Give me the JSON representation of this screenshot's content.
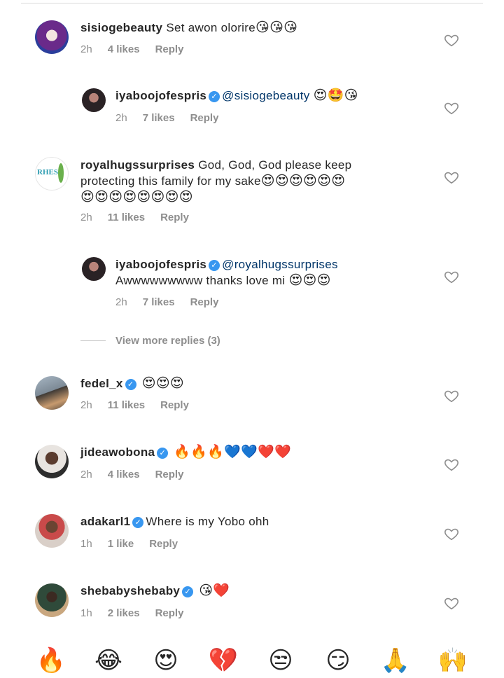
{
  "comments": [
    {
      "username": "sisiogebeauty",
      "verified": false,
      "text": "Set awon olorire",
      "emojis": "😘😘😘",
      "time": "2h",
      "likes": "4 likes",
      "reply": "Reply"
    },
    {
      "username": "iyaboojofespris",
      "verified": true,
      "mention": "@sisiogebeauty",
      "emojis": "😍🤩😘",
      "time": "2h",
      "likes": "7 likes",
      "reply": "Reply"
    },
    {
      "username": "royalhugssurprises",
      "verified": false,
      "text_line1": "God, God, God please keep",
      "text_line2": "protecting this family  for my sake",
      "emojis_line2": "😍😍😍😍😍😍",
      "emojis_line3": "😍😍😍😍😍😍😍😍",
      "time": "2h",
      "likes": "11 likes",
      "reply": "Reply",
      "avatar_text": "RHES"
    },
    {
      "username": "iyaboojofespris",
      "verified": true,
      "mention": "@royalhugssurprises",
      "text": "Awwwwwwwww  thanks love mi",
      "emojis": "😍😍😍",
      "time": "2h",
      "likes": "7 likes",
      "reply": "Reply"
    },
    {
      "username": "fedel_x",
      "verified": true,
      "emojis": "😍😍😍",
      "time": "2h",
      "likes": "11 likes",
      "reply": "Reply"
    },
    {
      "username": "jideawobona",
      "verified": true,
      "emojis": "🔥🔥🔥💙💙❤️❤️",
      "time": "2h",
      "likes": "4 likes",
      "reply": "Reply"
    },
    {
      "username": "adakarl1",
      "verified": true,
      "text": "Where is my Yobo ohh",
      "time": "1h",
      "likes": "1 like",
      "reply": "Reply"
    },
    {
      "username": "shebabyshebaby",
      "verified": true,
      "emojis": "😘❤️",
      "time": "1h",
      "likes": "2 likes",
      "reply": "Reply"
    }
  ],
  "view_more": "View more replies (3)",
  "emoji_bar": [
    "🔥",
    "😂",
    "😍",
    "💔",
    "😒",
    "😏",
    "🙏",
    "🙌"
  ],
  "colors": {
    "username": "#262626",
    "meta": "#8e8e8e",
    "mention": "#003569",
    "verified": "#3897f0"
  }
}
